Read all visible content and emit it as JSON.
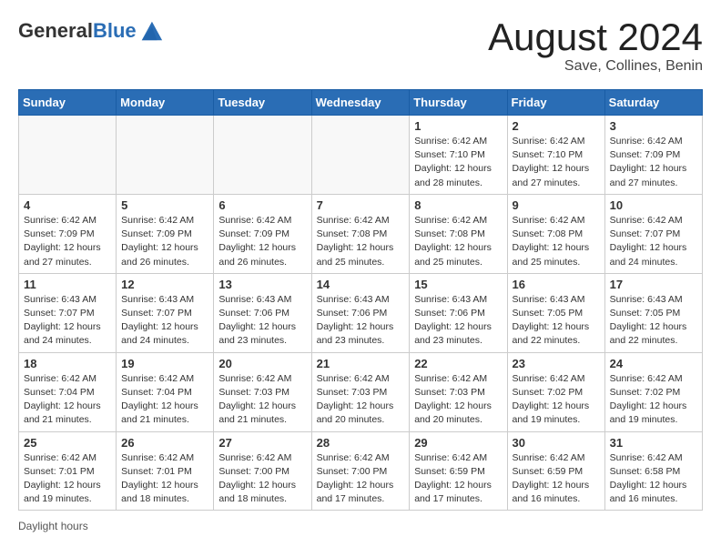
{
  "header": {
    "logo_general": "General",
    "logo_blue": "Blue",
    "month": "August 2024",
    "location": "Save, Collines, Benin"
  },
  "weekdays": [
    "Sunday",
    "Monday",
    "Tuesday",
    "Wednesday",
    "Thursday",
    "Friday",
    "Saturday"
  ],
  "weeks": [
    [
      {
        "day": "",
        "info": ""
      },
      {
        "day": "",
        "info": ""
      },
      {
        "day": "",
        "info": ""
      },
      {
        "day": "",
        "info": ""
      },
      {
        "day": "1",
        "info": "Sunrise: 6:42 AM\nSunset: 7:10 PM\nDaylight: 12 hours and 28 minutes."
      },
      {
        "day": "2",
        "info": "Sunrise: 6:42 AM\nSunset: 7:10 PM\nDaylight: 12 hours and 27 minutes."
      },
      {
        "day": "3",
        "info": "Sunrise: 6:42 AM\nSunset: 7:09 PM\nDaylight: 12 hours and 27 minutes."
      }
    ],
    [
      {
        "day": "4",
        "info": "Sunrise: 6:42 AM\nSunset: 7:09 PM\nDaylight: 12 hours and 27 minutes."
      },
      {
        "day": "5",
        "info": "Sunrise: 6:42 AM\nSunset: 7:09 PM\nDaylight: 12 hours and 26 minutes."
      },
      {
        "day": "6",
        "info": "Sunrise: 6:42 AM\nSunset: 7:09 PM\nDaylight: 12 hours and 26 minutes."
      },
      {
        "day": "7",
        "info": "Sunrise: 6:42 AM\nSunset: 7:08 PM\nDaylight: 12 hours and 25 minutes."
      },
      {
        "day": "8",
        "info": "Sunrise: 6:42 AM\nSunset: 7:08 PM\nDaylight: 12 hours and 25 minutes."
      },
      {
        "day": "9",
        "info": "Sunrise: 6:42 AM\nSunset: 7:08 PM\nDaylight: 12 hours and 25 minutes."
      },
      {
        "day": "10",
        "info": "Sunrise: 6:42 AM\nSunset: 7:07 PM\nDaylight: 12 hours and 24 minutes."
      }
    ],
    [
      {
        "day": "11",
        "info": "Sunrise: 6:43 AM\nSunset: 7:07 PM\nDaylight: 12 hours and 24 minutes."
      },
      {
        "day": "12",
        "info": "Sunrise: 6:43 AM\nSunset: 7:07 PM\nDaylight: 12 hours and 24 minutes."
      },
      {
        "day": "13",
        "info": "Sunrise: 6:43 AM\nSunset: 7:06 PM\nDaylight: 12 hours and 23 minutes."
      },
      {
        "day": "14",
        "info": "Sunrise: 6:43 AM\nSunset: 7:06 PM\nDaylight: 12 hours and 23 minutes."
      },
      {
        "day": "15",
        "info": "Sunrise: 6:43 AM\nSunset: 7:06 PM\nDaylight: 12 hours and 23 minutes."
      },
      {
        "day": "16",
        "info": "Sunrise: 6:43 AM\nSunset: 7:05 PM\nDaylight: 12 hours and 22 minutes."
      },
      {
        "day": "17",
        "info": "Sunrise: 6:43 AM\nSunset: 7:05 PM\nDaylight: 12 hours and 22 minutes."
      }
    ],
    [
      {
        "day": "18",
        "info": "Sunrise: 6:42 AM\nSunset: 7:04 PM\nDaylight: 12 hours and 21 minutes."
      },
      {
        "day": "19",
        "info": "Sunrise: 6:42 AM\nSunset: 7:04 PM\nDaylight: 12 hours and 21 minutes."
      },
      {
        "day": "20",
        "info": "Sunrise: 6:42 AM\nSunset: 7:03 PM\nDaylight: 12 hours and 21 minutes."
      },
      {
        "day": "21",
        "info": "Sunrise: 6:42 AM\nSunset: 7:03 PM\nDaylight: 12 hours and 20 minutes."
      },
      {
        "day": "22",
        "info": "Sunrise: 6:42 AM\nSunset: 7:03 PM\nDaylight: 12 hours and 20 minutes."
      },
      {
        "day": "23",
        "info": "Sunrise: 6:42 AM\nSunset: 7:02 PM\nDaylight: 12 hours and 19 minutes."
      },
      {
        "day": "24",
        "info": "Sunrise: 6:42 AM\nSunset: 7:02 PM\nDaylight: 12 hours and 19 minutes."
      }
    ],
    [
      {
        "day": "25",
        "info": "Sunrise: 6:42 AM\nSunset: 7:01 PM\nDaylight: 12 hours and 19 minutes."
      },
      {
        "day": "26",
        "info": "Sunrise: 6:42 AM\nSunset: 7:01 PM\nDaylight: 12 hours and 18 minutes."
      },
      {
        "day": "27",
        "info": "Sunrise: 6:42 AM\nSunset: 7:00 PM\nDaylight: 12 hours and 18 minutes."
      },
      {
        "day": "28",
        "info": "Sunrise: 6:42 AM\nSunset: 7:00 PM\nDaylight: 12 hours and 17 minutes."
      },
      {
        "day": "29",
        "info": "Sunrise: 6:42 AM\nSunset: 6:59 PM\nDaylight: 12 hours and 17 minutes."
      },
      {
        "day": "30",
        "info": "Sunrise: 6:42 AM\nSunset: 6:59 PM\nDaylight: 12 hours and 16 minutes."
      },
      {
        "day": "31",
        "info": "Sunrise: 6:42 AM\nSunset: 6:58 PM\nDaylight: 12 hours and 16 minutes."
      }
    ]
  ],
  "footer": {
    "daylight_label": "Daylight hours"
  }
}
